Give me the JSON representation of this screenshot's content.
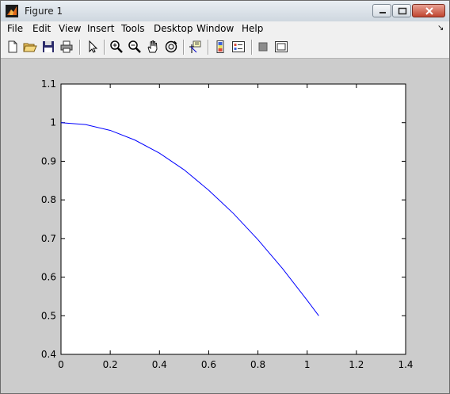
{
  "window": {
    "title": "Figure 1"
  },
  "menu": {
    "items": [
      "File",
      "Edit",
      "View",
      "Insert",
      "Tools",
      "Desktop",
      "Window",
      "Help"
    ]
  },
  "chart_data": {
    "type": "line",
    "title": "",
    "xlabel": "",
    "ylabel": "",
    "xlim": [
      0,
      1.4
    ],
    "ylim": [
      0.4,
      1.1
    ],
    "xticks": [
      "0",
      "0.2",
      "0.4",
      "0.6",
      "0.8",
      "1",
      "1.2",
      "1.4"
    ],
    "yticks": [
      "0.4",
      "0.5",
      "0.6",
      "0.7",
      "0.8",
      "0.9",
      "1",
      "1.1"
    ],
    "grid": false,
    "series": [
      {
        "color": "#0000ff",
        "x": [
          0,
          0.1,
          0.2,
          0.3,
          0.4,
          0.5,
          0.6,
          0.7,
          0.8,
          0.9,
          1.0,
          1.047
        ],
        "y": [
          1.0,
          0.995,
          0.98,
          0.955,
          0.921,
          0.878,
          0.825,
          0.765,
          0.697,
          0.622,
          0.54,
          0.5
        ]
      }
    ]
  }
}
